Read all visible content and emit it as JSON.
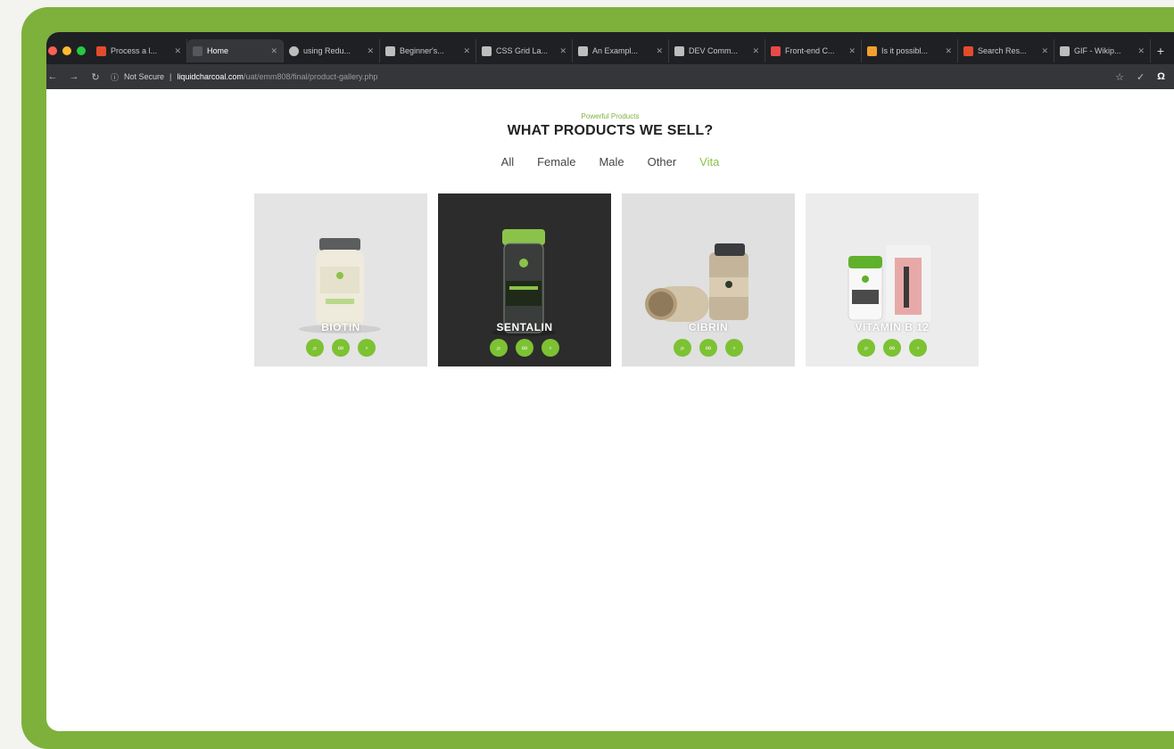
{
  "browser": {
    "tabs": [
      {
        "title": "Process a l...",
        "color": "#e34b2f",
        "active": false
      },
      {
        "title": "Home",
        "color": "#3a3b3f",
        "active": true
      },
      {
        "title": "using Redu...",
        "color": "#bdbdbd",
        "active": false
      },
      {
        "title": "Beginner's...",
        "color": "#bdbdbd",
        "active": false
      },
      {
        "title": "CSS Grid La...",
        "color": "#bdbdbd",
        "active": false
      },
      {
        "title": "An Exampl...",
        "color": "#bdbdbd",
        "active": false
      },
      {
        "title": "DEV Comm...",
        "color": "#bdbdbd",
        "active": false
      },
      {
        "title": "Front-end C...",
        "color": "#e84a4a",
        "active": false
      },
      {
        "title": "Is it possibl...",
        "color": "#f0a030",
        "active": false
      },
      {
        "title": "Search Res...",
        "color": "#e34b2f",
        "active": false
      },
      {
        "title": "GIF - Wikip...",
        "color": "#bdbdbd",
        "active": false
      }
    ],
    "new_tab_label": "+",
    "security_label": "Not Secure",
    "url_host": "liquidcharcoal.com",
    "url_path": "/uat/emm808/final/product-gallery.php"
  },
  "page": {
    "eyebrow": "Powerful Products",
    "heading": "WHAT PRODUCTS WE SELL?",
    "filters": [
      {
        "label": "All",
        "active": false
      },
      {
        "label": "Female",
        "active": false
      },
      {
        "label": "Male",
        "active": false
      },
      {
        "label": "Other",
        "active": false
      },
      {
        "label": "Vita",
        "active": true
      }
    ],
    "products": [
      {
        "name": "BIOTIN",
        "background": "#e4e4e4"
      },
      {
        "name": "SENTALIN",
        "background": "#2c2c2c"
      },
      {
        "name": "CIBRIN",
        "background": "#e0e0e0"
      },
      {
        "name": "VITAMIN B 12",
        "background": "#ececec"
      }
    ],
    "action_icons": [
      "search-icon",
      "link-icon",
      "cart-icon"
    ],
    "accent_color": "#7cc232",
    "frame_color": "#7db13c"
  }
}
